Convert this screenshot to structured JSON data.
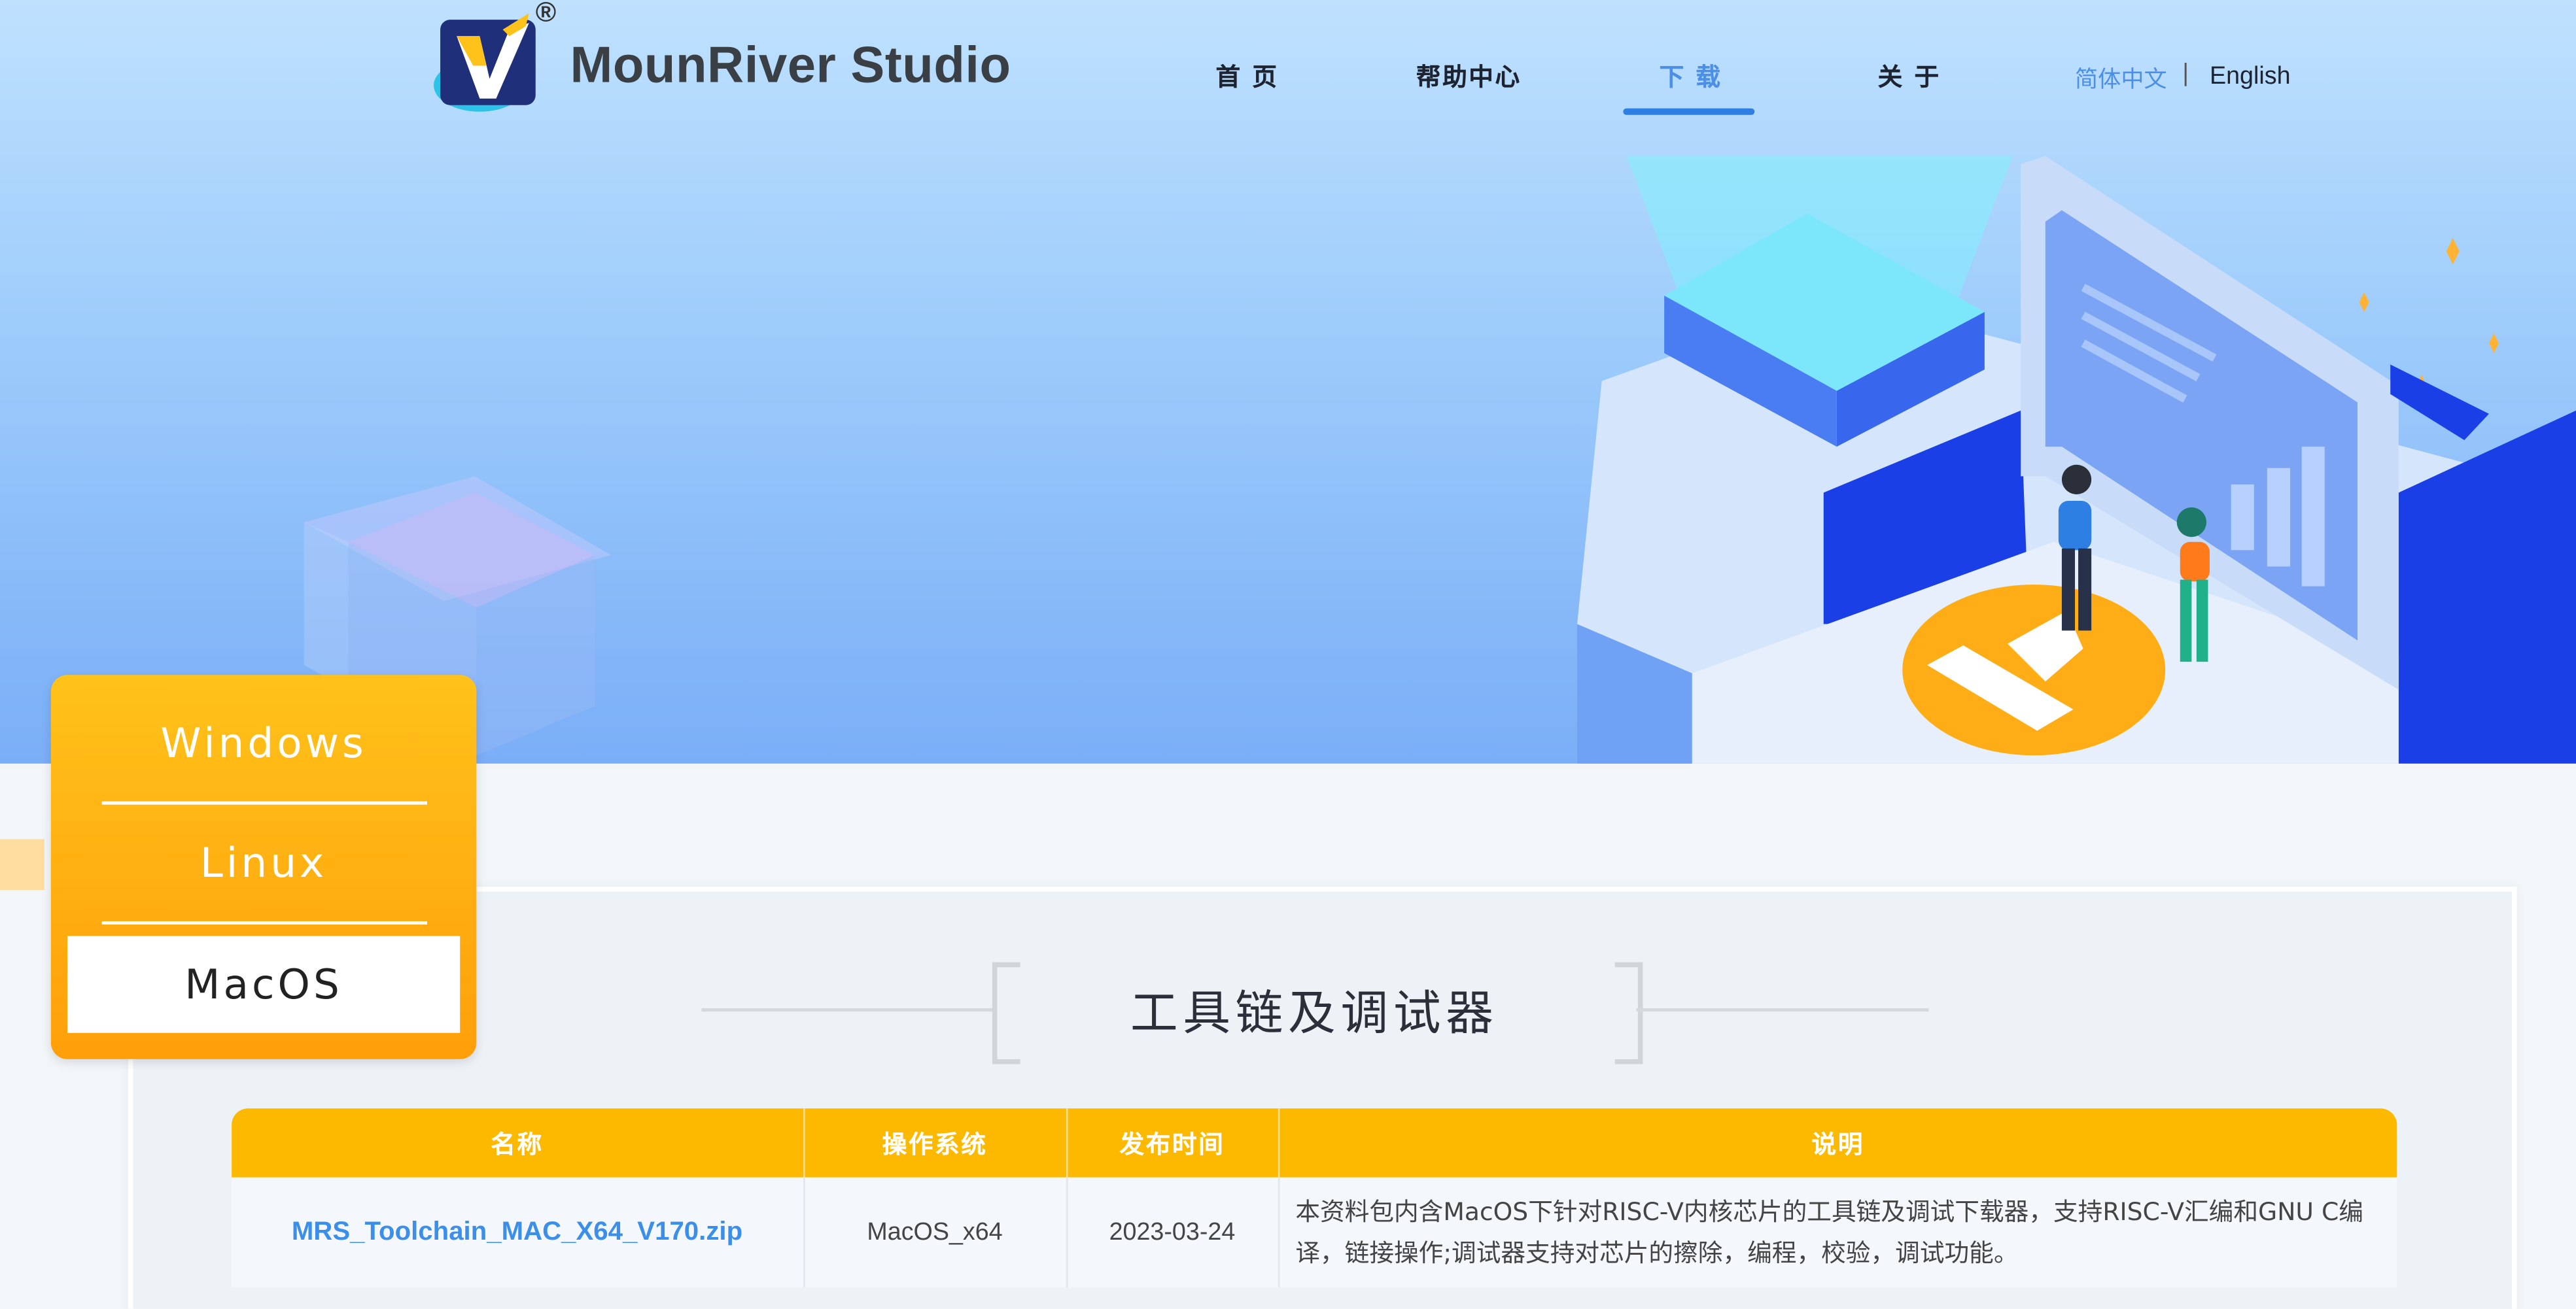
{
  "brand": {
    "name": "MounRiver  Studio",
    "reg": "®"
  },
  "nav": {
    "items": [
      {
        "label": "首 页"
      },
      {
        "label": "帮助中心"
      },
      {
        "label": "下 载"
      },
      {
        "label": "关 于"
      }
    ],
    "active_index": 2,
    "lang_cn": "简体中文",
    "lang_sep": "|",
    "lang_en": "English"
  },
  "os_panel": {
    "items": [
      "Windows",
      "Linux",
      "MacOS"
    ],
    "selected": "MacOS"
  },
  "section": {
    "title": "工具链及调试器"
  },
  "table": {
    "headers": [
      "名称",
      "操作系统",
      "发布时间",
      "说明"
    ],
    "rows": [
      {
        "name": "MRS_Toolchain_MAC_X64_V170.zip",
        "os": "MacOS_x64",
        "date": "2023-03-24",
        "desc": "本资料包内含MacOS下针对RISC-V内核芯片的工具链及调试下载器，支持RISC-V汇编和GNU C编译，链接操作;调试器支持对芯片的擦除，编程，校验，调试功能。"
      }
    ]
  },
  "colors": {
    "accent": "#fdb900",
    "nav_active": "#4b8fe6",
    "link": "#3c8fe8"
  }
}
